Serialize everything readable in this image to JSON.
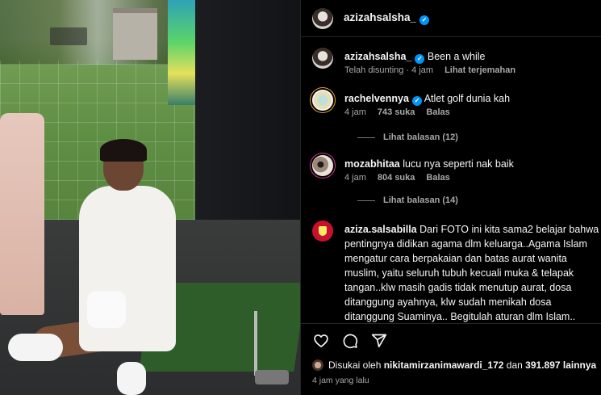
{
  "post": {
    "author": "azizahsalsha_",
    "verified": true
  },
  "caption": {
    "username": "azizahsalsha_",
    "text": "Been a while",
    "edited": "Telah disunting · 4 jam",
    "translate": "Lihat terjemahan"
  },
  "comments": [
    {
      "username": "rachelvennya",
      "verified": true,
      "text": "Atlet golf dunia kah",
      "time": "4 jam",
      "likes": "743 suka",
      "reply": "Balas",
      "view_replies": "Lihat balasan (12)"
    },
    {
      "username": "mozabhitaa",
      "verified": false,
      "text": "lucu nya seperti nak baik",
      "time": "4 jam",
      "likes": "804 suka",
      "reply": "Balas",
      "view_replies": "Lihat balasan (14)"
    },
    {
      "username": "aziza.salsabilla",
      "verified": false,
      "text": "Dari FOTO ini kita sama2 belajar bahwa pentingnya didikan agama dlm keluarga..Agama Islam mengatur cara berpakaian dan batas aurat wanita muslim, yaitu seluruh tubuh kecuali muka & telapak tangan..klw masih gadis tidak menutup aurat, dosa ditanggung ayahnya, klw sudah menikah dosa ditanggung Suaminya.. Begitulah aturan dlm Islam.. Mereka terlihat bahagia hidup bergelimang harta,Cantik,terkenal dll tapi mereka lupa klw hidup didunia ini hnya sementara... Mereka terlena dg"
    }
  ],
  "footer": {
    "liked_prefix": "Disukai oleh",
    "liked_user": "nikitamirzanimawardi_172",
    "liked_and": "dan",
    "liked_count": "391.897 lainnya",
    "time_ago": "4 jam yang lalu"
  },
  "icons": {
    "like": "heart-icon",
    "comment": "comment-icon",
    "share": "send-icon"
  },
  "colors": {
    "verified": "#0095f6",
    "secondary_text": "#a8a8a8"
  }
}
